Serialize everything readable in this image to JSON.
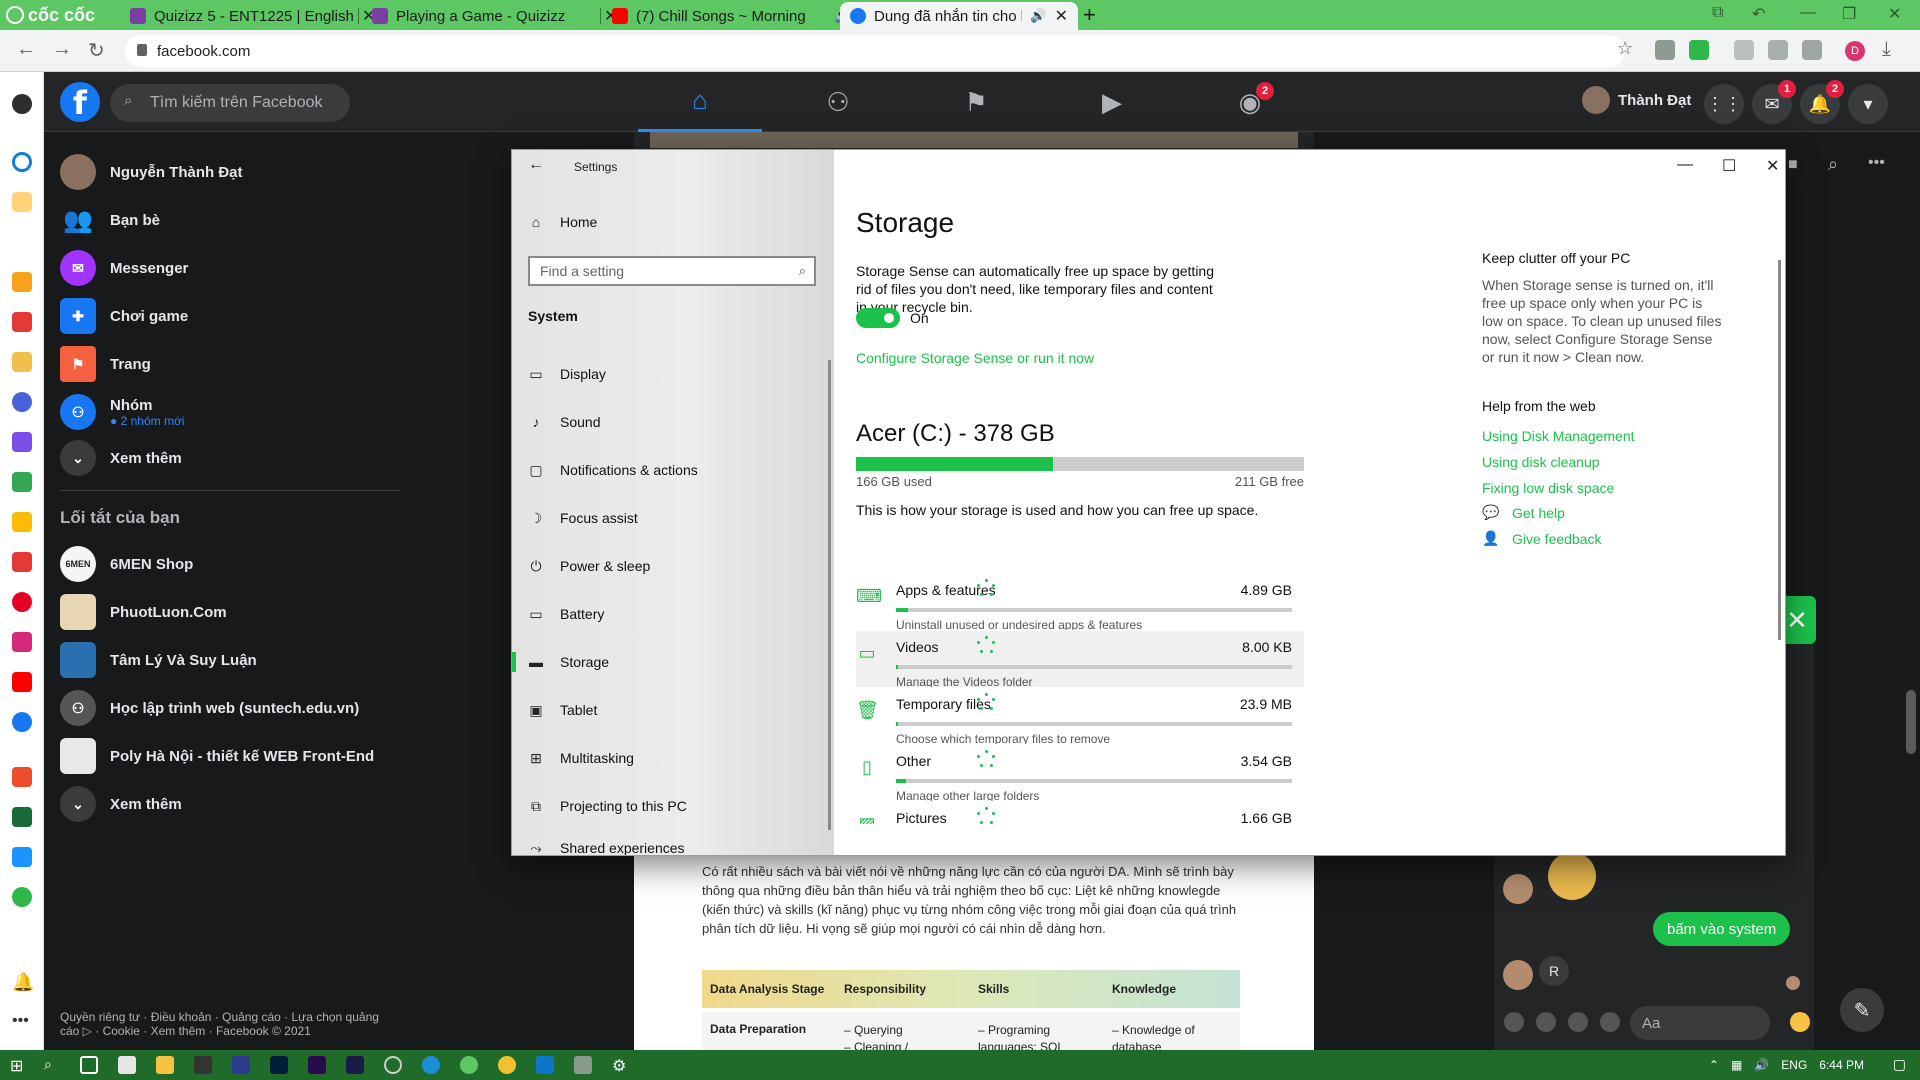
{
  "browser": {
    "brand": "cốc cốc",
    "tabs": [
      {
        "label": "Quizizz 5 - ENT1225 | English",
        "color": "#7a3fa0"
      },
      {
        "label": "Playing a Game - Quizizz",
        "color": "#7a3fa0"
      },
      {
        "label": "(7) Chill Songs ~ Morning",
        "color": "#ff0000"
      },
      {
        "label": "Dung đã nhắn tin cho bạn",
        "color": "#1877f2"
      }
    ],
    "url": "facebook.com",
    "profile_initial": "D"
  },
  "facebook": {
    "search_placeholder": "Tìm kiếm trên Facebook",
    "user_short": "Thành Đạt",
    "groups_badge": "2",
    "messenger_badge": "1",
    "notif_badge": "2",
    "left_menu": [
      {
        "label": "Nguyễn Thành Đạt",
        "icon": "profile-avatar",
        "color": "#8a7060"
      },
      {
        "label": "Bạn bè",
        "icon": "friends-icon",
        "color": "#1877f2"
      },
      {
        "label": "Messenger",
        "icon": "messenger-icon",
        "color": "#a033ff"
      },
      {
        "label": "Chơi game",
        "icon": "game-icon",
        "color": "#1877f2"
      },
      {
        "label": "Trang",
        "icon": "flag-icon",
        "color": "#f56040"
      },
      {
        "label": "Nhóm",
        "icon": "groups-icon",
        "color": "#1877f2",
        "sub": "● 2 nhóm mới"
      },
      {
        "label": "Xem thêm",
        "icon": "chevron-down-icon",
        "color": "#3a3b3c"
      }
    ],
    "shortcuts_title": "Lối tắt của bạn",
    "shortcuts": [
      {
        "label": "6MEN Shop",
        "color": "#f5f5f5"
      },
      {
        "label": "PhuotLuon.Com",
        "color": "#e8d6b5"
      },
      {
        "label": "Tâm Lý Và Suy Luận",
        "color": "#2a6fb0"
      },
      {
        "label": "Học lập trình web (suntech.edu.vn)",
        "color": "#555555"
      },
      {
        "label": "Poly Hà Nội - thiết kế WEB Front-End",
        "color": "#e8e8e8"
      },
      {
        "label": "Xem thêm",
        "color": "#3a3b3c"
      }
    ],
    "footer": "Quyền riêng tư · Điều khoản · Quảng cáo · Lựa chọn quảng cáo ▷ · Cookie · Xem thêm · Facebook © 2021",
    "article_text": "Có rất nhiều sách và bài viết nói về những năng lực cần có của người DA. Mình sẽ trình bày thông qua những điều bản thân hiểu và trải nghiệm theo bố cục: Liệt kê những knowlegde (kiến thức) và skills (kĩ năng) phục vụ từng nhóm công việc trong mỗi giai đoạn của quá trình phân tích dữ liệu. Hi vọng sẽ giúp mọi người có cái nhìn dễ dàng hơn.",
    "table_headers": [
      "Data Analysis Stage",
      "Responsibility",
      "Skills",
      "Knowledge"
    ],
    "table_row": [
      "Data Preparation",
      "– Querying\n– Cleaning /",
      "– Programing\nlanguages: SQL",
      "– Knowledge of\ndatabase"
    ]
  },
  "chat": {
    "message": "bấm vào system",
    "r_initial": "R",
    "input_placeholder": "Aa"
  },
  "settings": {
    "window_title": "Settings",
    "home": "Home",
    "find_placeholder": "Find a setting",
    "section": "System",
    "nav": [
      {
        "label": "Display",
        "icon": "display-icon"
      },
      {
        "label": "Sound",
        "icon": "sound-icon"
      },
      {
        "label": "Notifications & actions",
        "icon": "notifications-icon"
      },
      {
        "label": "Focus assist",
        "icon": "moon-icon"
      },
      {
        "label": "Power & sleep",
        "icon": "power-icon"
      },
      {
        "label": "Battery",
        "icon": "battery-icon"
      },
      {
        "label": "Storage",
        "icon": "storage-icon"
      },
      {
        "label": "Tablet",
        "icon": "tablet-icon"
      },
      {
        "label": "Multitasking",
        "icon": "multitasking-icon"
      },
      {
        "label": "Projecting to this PC",
        "icon": "projecting-icon"
      },
      {
        "label": "Shared experiences",
        "icon": "shared-icon"
      }
    ],
    "page_title": "Storage",
    "sense_desc": "Storage Sense can automatically free up space by getting rid of files you don't need, like temporary files and content in your recycle bin.",
    "toggle_label": "On",
    "configure_link": "Configure Storage Sense or run it now",
    "drive_title": "Acer (C:) - 378 GB",
    "used": "166 GB used",
    "free": "211 GB free",
    "used_fraction": 0.44,
    "usage_desc": "This is how your storage is used and how you can free up space.",
    "categories": [
      {
        "name": "Apps & features",
        "size": "4.89 GB",
        "desc": "Uninstall unused or undesired apps & features",
        "icon": "apps-icon",
        "fraction": 0.03
      },
      {
        "name": "Videos",
        "size": "8.00 KB",
        "desc": "Manage the Videos folder",
        "icon": "video-icon",
        "fraction": 0.0
      },
      {
        "name": "Temporary files",
        "size": "23.9 MB",
        "desc": "Choose which temporary files to remove",
        "icon": "trash-icon",
        "fraction": 0.0
      },
      {
        "name": "Other",
        "size": "3.54 GB",
        "desc": "Manage other large folders",
        "icon": "folder-icon",
        "fraction": 0.02
      },
      {
        "name": "Pictures",
        "size": "1.66 GB",
        "desc": "",
        "icon": "picture-icon",
        "fraction": 0.01
      }
    ],
    "clutter_title": "Keep clutter off your PC",
    "clutter_text": "When Storage sense is turned on, it'll free up space only when your PC is low on space. To clean up unused files now, select Configure Storage Sense or run it now > Clean now.",
    "help_title": "Help from the web",
    "help_links": [
      "Using Disk Management",
      "Using disk cleanup",
      "Fixing low disk space"
    ],
    "get_help": "Get help",
    "give_feedback": "Give feedback"
  },
  "taskbar": {
    "lang": "ENG",
    "time": "6:44 PM"
  }
}
